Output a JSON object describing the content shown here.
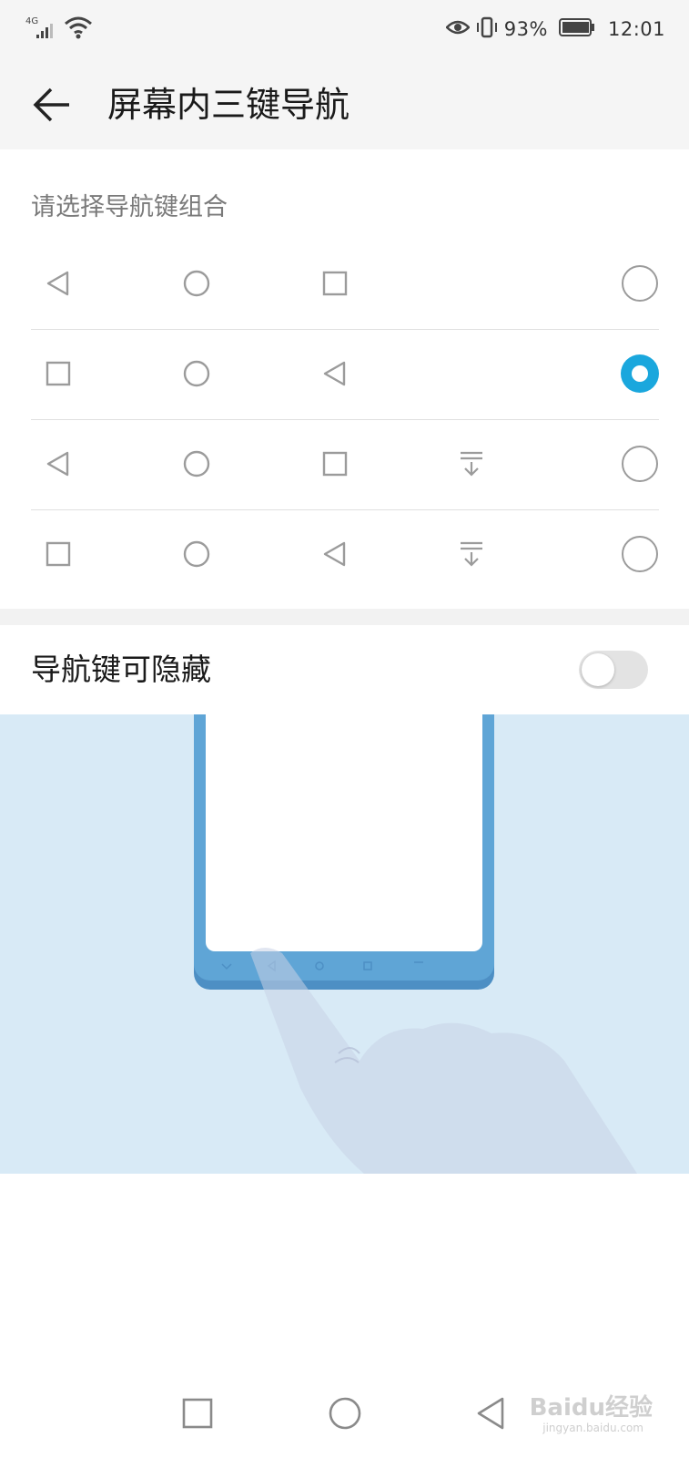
{
  "status_bar": {
    "network_label": "4G",
    "battery_percent": "93%",
    "time": "12:01"
  },
  "header": {
    "title": "屏幕内三键导航"
  },
  "section": {
    "title": "请选择导航键组合"
  },
  "options": [
    {
      "icons": [
        "back-icon",
        "home-icon",
        "recent-icon"
      ],
      "selected": false
    },
    {
      "icons": [
        "recent-icon",
        "home-icon",
        "back-icon"
      ],
      "selected": true
    },
    {
      "icons": [
        "back-icon",
        "home-icon",
        "recent-icon",
        "hide-nav-icon"
      ],
      "selected": false
    },
    {
      "icons": [
        "recent-icon",
        "home-icon",
        "back-icon",
        "hide-nav-icon"
      ],
      "selected": false
    }
  ],
  "hide_toggle": {
    "label": "导航键可隐藏",
    "on": false
  },
  "watermark": {
    "brand": "Baidu经验",
    "site": "jingyan.baidu.com"
  },
  "colors": {
    "accent": "#1aa7dd",
    "illustration_bg": "#d8eaf6",
    "phone_frame": "#5fa5d6"
  }
}
